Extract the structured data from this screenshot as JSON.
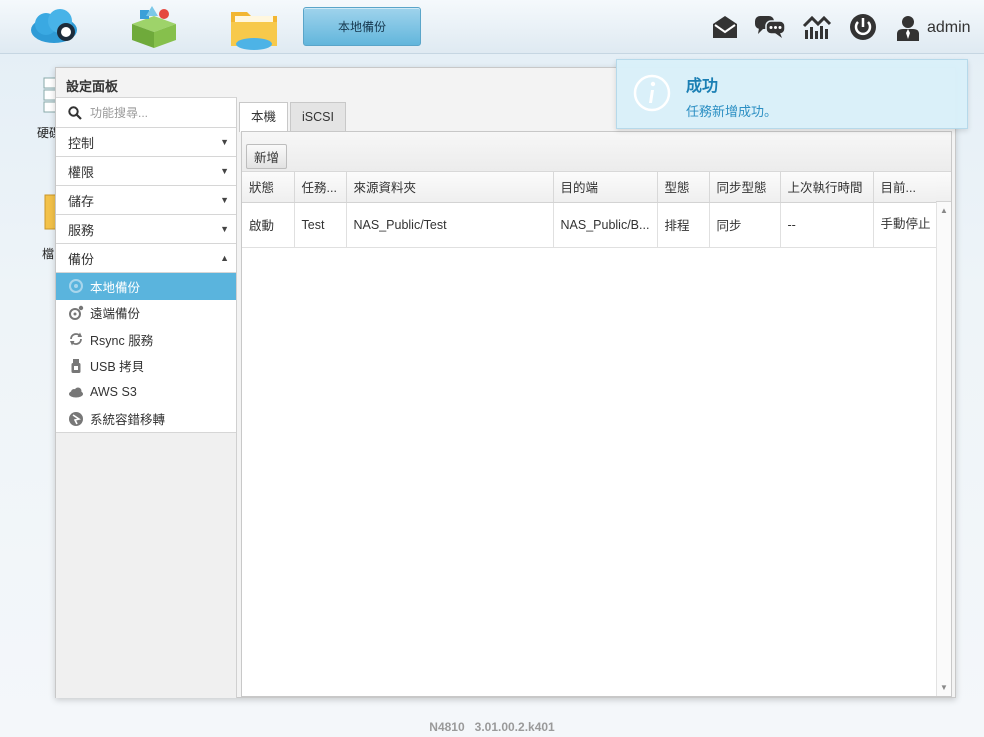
{
  "topbar": {
    "apps": [
      "cloud-app",
      "app-center",
      "file-manager"
    ],
    "active_task": "本地備份",
    "tools": [
      "mail-icon",
      "chat-icon",
      "monitor-icon",
      "power-icon"
    ],
    "user": "admin"
  },
  "desktop": {
    "labels": [
      "硬碟",
      "檔"
    ]
  },
  "panel": {
    "title": "設定面板",
    "search": {
      "placeholder": "功能搜尋...",
      "value": ""
    },
    "categories": [
      {
        "label": "控制",
        "state": "collapsed"
      },
      {
        "label": "權限",
        "state": "collapsed"
      },
      {
        "label": "儲存",
        "state": "collapsed"
      },
      {
        "label": "服務",
        "state": "collapsed"
      },
      {
        "label": "備份",
        "state": "expanded"
      }
    ],
    "backup_items": [
      {
        "label": "本地備份",
        "icon": "local-backup-icon",
        "active": true
      },
      {
        "label": "遠端備份",
        "icon": "remote-backup-icon",
        "active": false
      },
      {
        "label": "Rsync 服務",
        "icon": "sync-icon",
        "active": false
      },
      {
        "label": "USB 拷貝",
        "icon": "usb-icon",
        "active": false
      },
      {
        "label": "AWS S3",
        "icon": "cloud-icon",
        "active": false
      },
      {
        "label": "系統容錯移轉",
        "icon": "failover-icon",
        "active": false
      }
    ]
  },
  "content": {
    "tabs": [
      {
        "label": "本機",
        "active": true
      },
      {
        "label": "iSCSI",
        "active": false
      }
    ],
    "add_label": "新增",
    "columns": [
      "狀態",
      "任務...",
      "來源資料夾",
      "目的端",
      "型態",
      "同步型態",
      "上次執行時間",
      "目前..."
    ],
    "rows": [
      [
        "啟動",
        "Test",
        "NAS_Public/Test",
        "NAS_Public/B...",
        "排程",
        "同步",
        "--",
        "手動停止"
      ]
    ]
  },
  "notification": {
    "title": "成功",
    "message": "任務新增成功。"
  },
  "footer": "N4810   3.01.00.2.k401"
}
